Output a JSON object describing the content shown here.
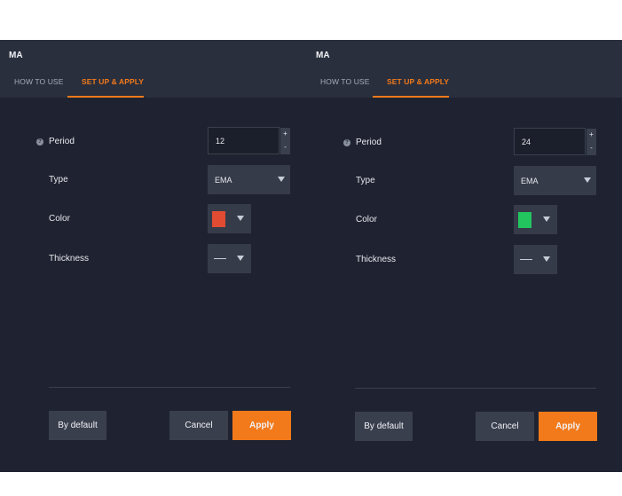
{
  "panels": [
    {
      "title": "MA",
      "tabs": {
        "how_to_use": "HOW TO USE",
        "setup": "SET UP & APPLY"
      },
      "info_icon_glyph": "?",
      "fields": {
        "period_label": "Period",
        "period_value": "12",
        "type_label": "Type",
        "type_value": "EMA",
        "color_label": "Color",
        "color_value": "#e04b32",
        "thickness_label": "Thickness"
      },
      "stepper": {
        "plus": "+",
        "minus": "-"
      },
      "buttons": {
        "default": "By default",
        "cancel": "Cancel",
        "apply": "Apply"
      }
    },
    {
      "title": "MA",
      "tabs": {
        "how_to_use": "HOW TO USE",
        "setup": "SET UP & APPLY"
      },
      "info_icon_glyph": "?",
      "fields": {
        "period_label": "Period",
        "period_value": "24",
        "type_label": "Type",
        "type_value": "EMA",
        "color_label": "Color",
        "color_value": "#22c55e",
        "thickness_label": "Thickness"
      },
      "stepper": {
        "plus": "+",
        "minus": "-"
      },
      "buttons": {
        "default": "By default",
        "cancel": "Cancel",
        "apply": "Apply"
      }
    }
  ],
  "colors": {
    "accent": "#f27a1a",
    "panel_bg": "#1f2331",
    "header_bg": "#2a2f3d"
  }
}
